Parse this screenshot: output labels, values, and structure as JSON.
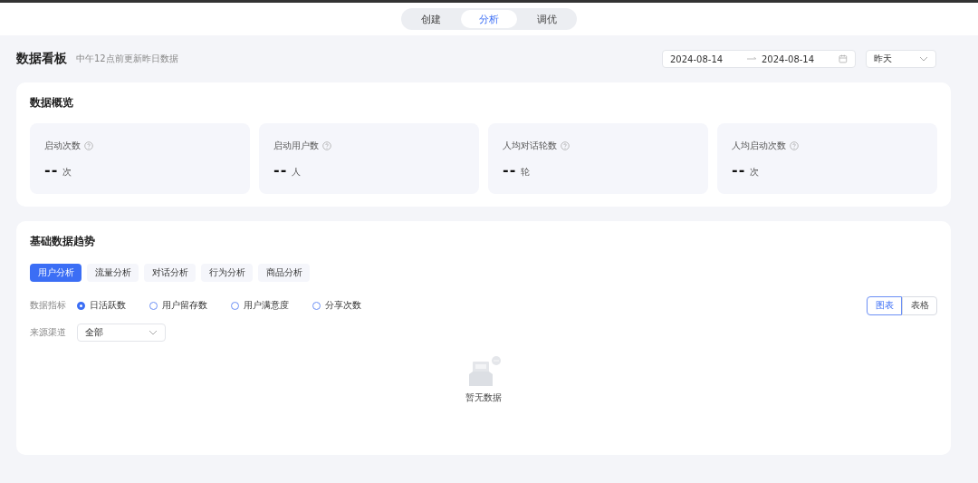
{
  "top_tabs": [
    {
      "label": "创建",
      "selected": false
    },
    {
      "label": "分析",
      "selected": true
    },
    {
      "label": "调优",
      "selected": false
    }
  ],
  "header": {
    "title": "数据看板",
    "subtitle": "中午12点前更新昨日数据",
    "date_start": "2024-08-14",
    "date_end": "2024-08-14",
    "period": "昨天"
  },
  "overview": {
    "title": "数据概览",
    "stats": [
      {
        "label": "启动次数",
        "value": "--",
        "unit": "次"
      },
      {
        "label": "启动用户数",
        "value": "--",
        "unit": "人"
      },
      {
        "label": "人均对话轮数",
        "value": "--",
        "unit": "轮"
      },
      {
        "label": "人均启动次数",
        "value": "--",
        "unit": "次"
      }
    ]
  },
  "trend": {
    "title": "基础数据趋势",
    "tabs": [
      {
        "label": "用户分析",
        "selected": true
      },
      {
        "label": "流量分析",
        "selected": false
      },
      {
        "label": "对话分析",
        "selected": false
      },
      {
        "label": "行为分析",
        "selected": false
      },
      {
        "label": "商品分析",
        "selected": false
      }
    ],
    "metric_label": "数据指标",
    "metrics": [
      {
        "label": "日活跃数",
        "selected": true
      },
      {
        "label": "用户留存数",
        "selected": false
      },
      {
        "label": "用户满意度",
        "selected": false
      },
      {
        "label": "分享次数",
        "selected": false
      }
    ],
    "views": [
      {
        "label": "图表",
        "selected": true
      },
      {
        "label": "表格",
        "selected": false
      }
    ],
    "source_label": "来源渠道",
    "source_value": "全部",
    "empty_text": "暂无数据"
  }
}
